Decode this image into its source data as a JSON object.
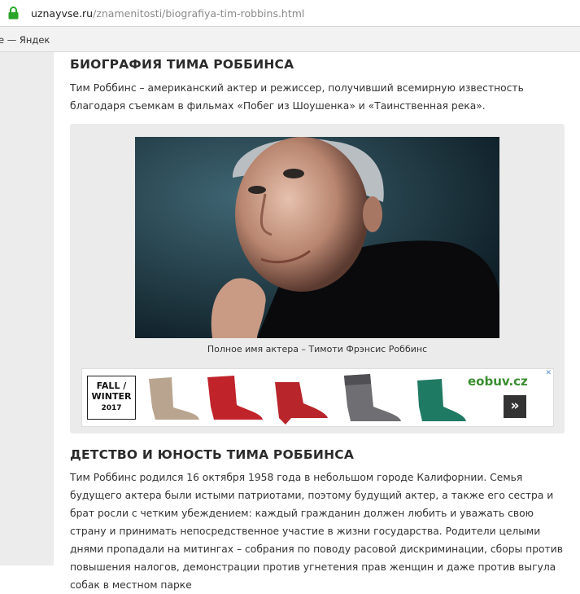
{
  "browser": {
    "url_host": "uznayvse.ru",
    "url_path": "/znamenitosti/biografiya-tim-robbins.html",
    "bookmark_label": "е — Яндек"
  },
  "article": {
    "heading_bio": "БИОГРАФИЯ ТИМА РОББИНСА",
    "intro": "Тим Роббинс – американский актер и режиссер, получивший всемирную известность благодаря съемкам в фильмах «Побег из Шоушенка» и «Таинственная река».",
    "photo_caption": "Полное имя актера – Тимоти Фрэнсис Роббинс",
    "heading_childhood": "ДЕТСТВО И ЮНОСТЬ ТИМА РОББИНСА",
    "childhood_text": "Тим Роббинс родился 16 октября 1958 года в небольшом городе Калифорнии. Семья будущего актера были истыми патриотами, поэтому будущий актер, а также его сестра и брат росли с четким убеждением: каждый гражданин должен любить и уважать свою страну и принимать непосредственное участие в жизни государства. Родители целыми днями пропадали на митингах – собрания по поводу расовой дискриминации, сборы против повышения налогов, демонстрации против угнетения прав женщин и даже против выгула собак в местном парке"
  },
  "ad": {
    "brand_line1": "FALL /",
    "brand_line2": "WINTER",
    "brand_line3": "2017",
    "logo": "eobuv.cz",
    "close": "✕",
    "arrow": "»"
  },
  "colors": {
    "lock": "#2aa52a",
    "logo_green": "#3a8d2f"
  }
}
